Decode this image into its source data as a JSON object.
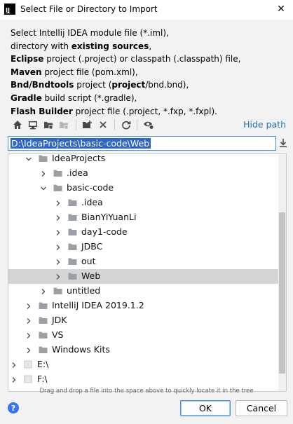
{
  "window": {
    "title": "Select File or Directory to Import",
    "app_icon_text": "IJ",
    "close_glyph": "✕"
  },
  "description": {
    "lines": [
      [
        {
          "text": "Select Intellij IDEA module file (*.iml),",
          "bold": false
        }
      ],
      [
        {
          "text": "directory with ",
          "bold": false
        },
        {
          "text": "existing sources",
          "bold": true
        },
        {
          "text": ",",
          "bold": false
        }
      ],
      [
        {
          "text": "Eclipse",
          "bold": true
        },
        {
          "text": " project (.project) or classpath (.classpath) file,",
          "bold": false
        }
      ],
      [
        {
          "text": "Maven",
          "bold": true
        },
        {
          "text": " project file (pom.xml),",
          "bold": false
        }
      ],
      [
        {
          "text": "Bnd/Bndtools",
          "bold": true
        },
        {
          "text": " project (",
          "bold": false
        },
        {
          "text": "project",
          "bold": true
        },
        {
          "text": "/bnd.bnd),",
          "bold": false
        }
      ],
      [
        {
          "text": "Gradle",
          "bold": true
        },
        {
          "text": " build script (*.gradle),",
          "bold": false
        }
      ],
      [
        {
          "text": "Flash Builder",
          "bold": true
        },
        {
          "text": " project file (.project, *.fxp, *.fxpl).",
          "bold": false
        }
      ]
    ]
  },
  "toolbar": {
    "icons": [
      "home-icon",
      "desktop-icon",
      "project-folder-icon",
      "module-folder-icon",
      "new-folder-icon",
      "delete-icon",
      "refresh-icon",
      "show-hidden-icon"
    ],
    "hide_path_label": "Hide path",
    "link_color": "#2470b3"
  },
  "path": {
    "value": "D:\\IdeaProjects\\basic-code\\Web"
  },
  "tree": {
    "rows": [
      {
        "label": "IdeaProjects",
        "depth": 2,
        "expanded": true,
        "selected": false,
        "type": "folder"
      },
      {
        "label": ".idea",
        "depth": 3,
        "expanded": false,
        "selected": false,
        "type": "folder"
      },
      {
        "label": "basic-code",
        "depth": 3,
        "expanded": true,
        "selected": false,
        "type": "folder"
      },
      {
        "label": ".idea",
        "depth": 4,
        "expanded": false,
        "selected": false,
        "type": "folder"
      },
      {
        "label": "BianYiYuanLi",
        "depth": 4,
        "expanded": false,
        "selected": false,
        "type": "folder"
      },
      {
        "label": "day1-code",
        "depth": 4,
        "expanded": false,
        "selected": false,
        "type": "folder"
      },
      {
        "label": "JDBC",
        "depth": 4,
        "expanded": false,
        "selected": false,
        "type": "folder"
      },
      {
        "label": "out",
        "depth": 4,
        "expanded": false,
        "selected": false,
        "type": "folder"
      },
      {
        "label": "Web",
        "depth": 4,
        "expanded": false,
        "selected": true,
        "type": "folder"
      },
      {
        "label": "untitled",
        "depth": 3,
        "expanded": false,
        "selected": false,
        "type": "folder"
      },
      {
        "label": "IntelliJ IDEA 2019.1.2",
        "depth": 2,
        "expanded": false,
        "selected": false,
        "type": "folder"
      },
      {
        "label": "JDK",
        "depth": 2,
        "expanded": false,
        "selected": false,
        "type": "folder"
      },
      {
        "label": "VS",
        "depth": 2,
        "expanded": false,
        "selected": false,
        "type": "folder"
      },
      {
        "label": "Windows Kits",
        "depth": 2,
        "expanded": false,
        "selected": false,
        "type": "folder"
      },
      {
        "label": "E:\\",
        "depth": 1,
        "expanded": false,
        "selected": false,
        "type": "drive"
      },
      {
        "label": "F:\\",
        "depth": 1,
        "expanded": false,
        "selected": false,
        "type": "drive"
      }
    ]
  },
  "hint_text": "Drag and drop a file into the space above to quickly locate it in the tree",
  "buttons": {
    "help": "?",
    "ok": "OK",
    "cancel": "Cancel"
  },
  "colors": {
    "selection_blue": "#2f65ca",
    "tree_selection": "#d5d5d5",
    "folder_gray": "#9aa0a6"
  }
}
